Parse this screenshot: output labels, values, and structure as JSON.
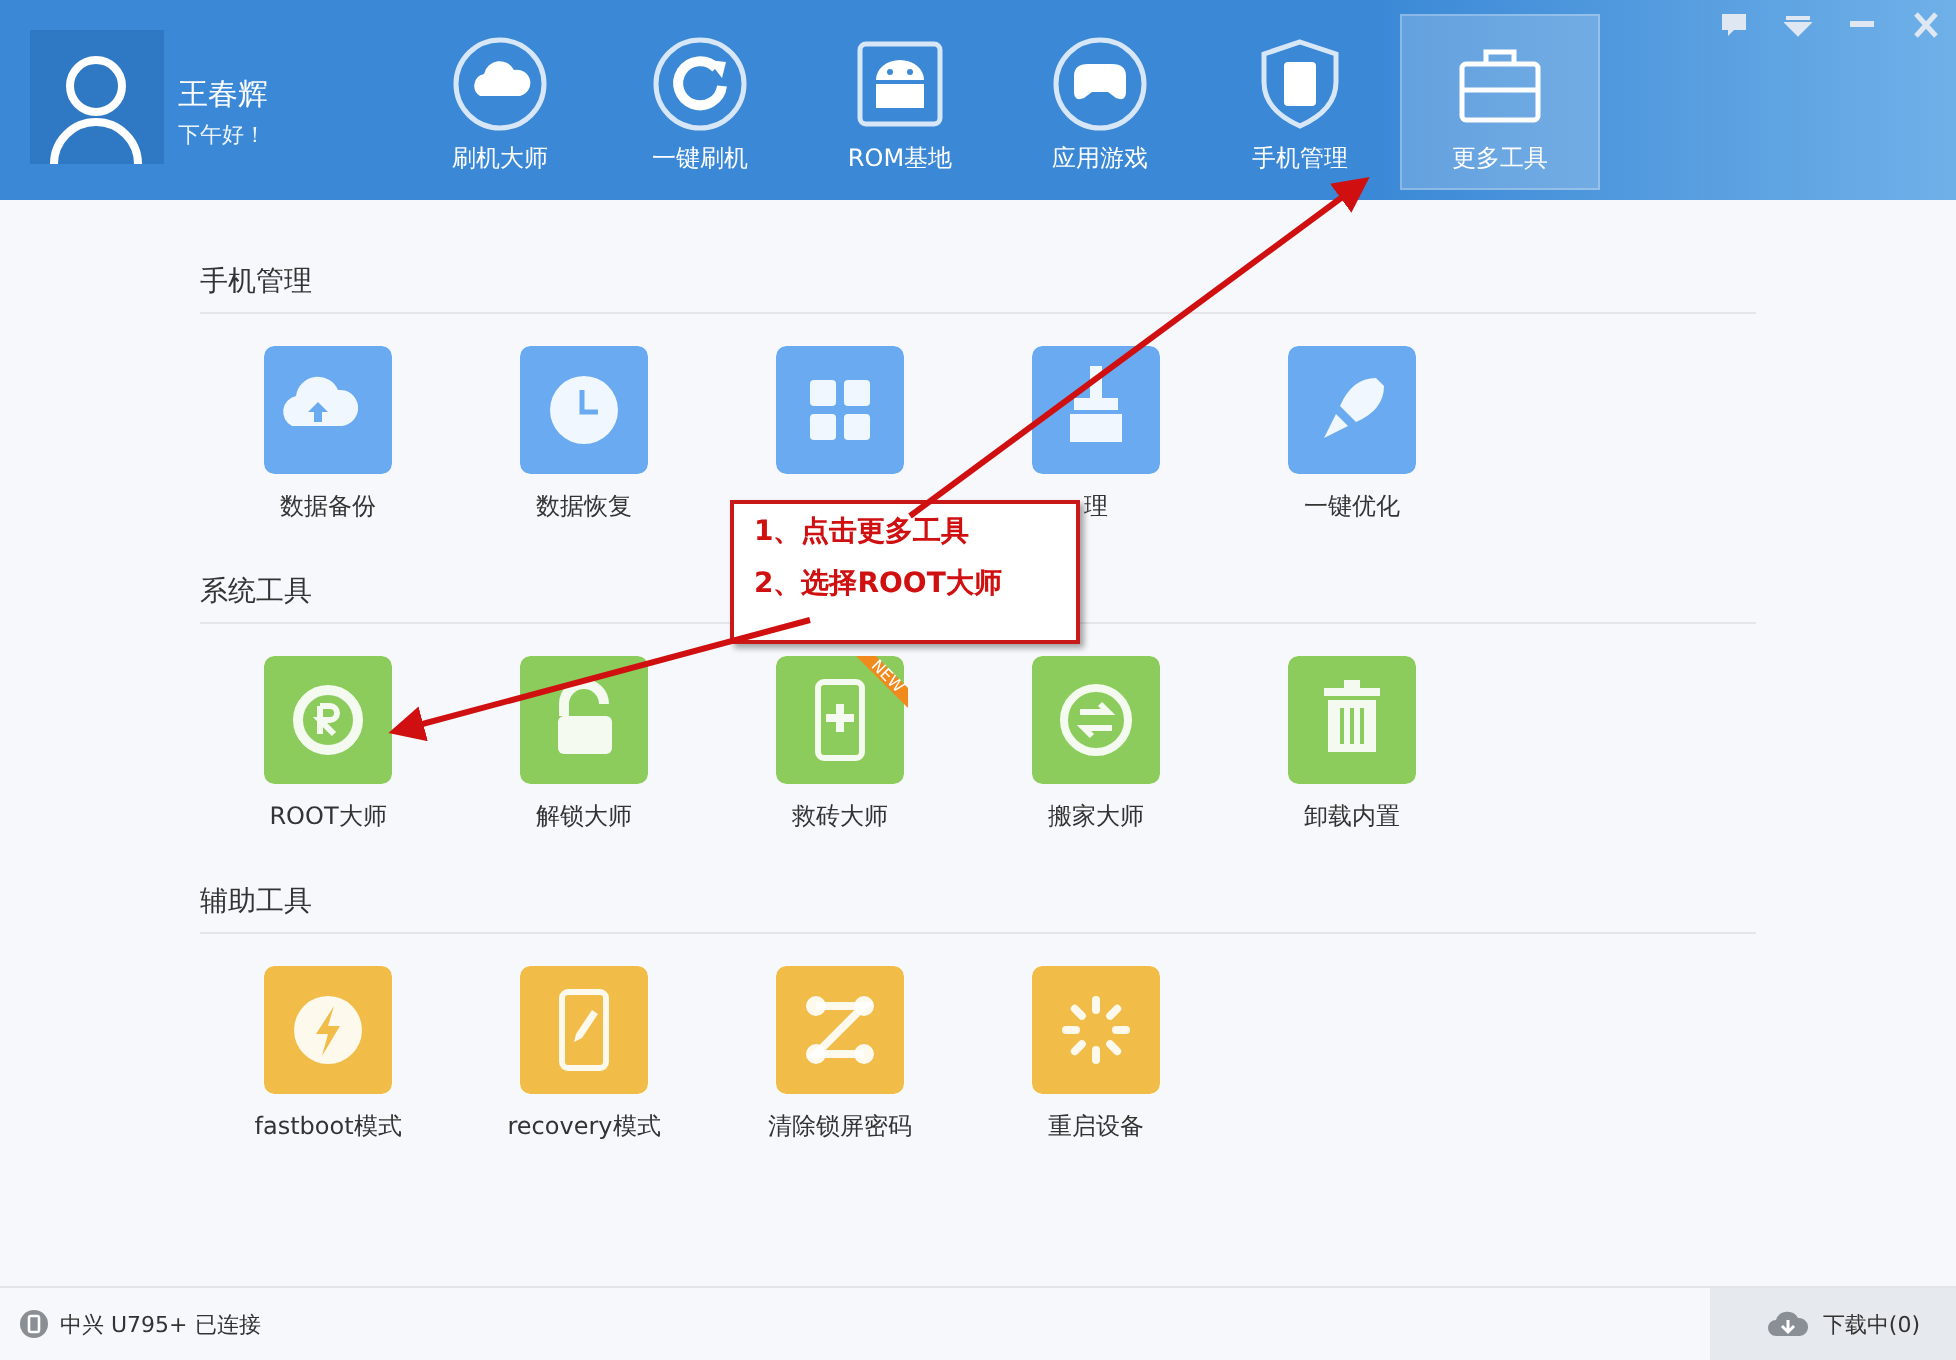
{
  "user": {
    "name": "王春辉",
    "greeting": "下午好！"
  },
  "nav": [
    {
      "label": "刷机大师",
      "selected": false
    },
    {
      "label": "一键刷机",
      "selected": false
    },
    {
      "label": "ROM基地",
      "selected": false
    },
    {
      "label": "应用游戏",
      "selected": false
    },
    {
      "label": "手机管理",
      "selected": false
    },
    {
      "label": "更多工具",
      "selected": true
    }
  ],
  "sections": [
    {
      "title": "手机管理",
      "color": "#6aaaf0",
      "tiles": [
        {
          "kind": "tool",
          "label": "数据备份"
        },
        {
          "kind": "tool",
          "label": "数据恢复"
        },
        {
          "kind": "tool"
        },
        {
          "kind": "tool",
          "label": "理"
        },
        {
          "kind": "tool",
          "label": "一键优化"
        }
      ]
    },
    {
      "title": "系统工具",
      "color": "#8ccc5c",
      "tiles": [
        {
          "kind": "tool",
          "label": "ROOT大师"
        },
        {
          "kind": "tool",
          "label": "解锁大师"
        },
        {
          "kind": "tool",
          "label": "救砖大师",
          "badge": "NEW"
        },
        {
          "kind": "tool",
          "label": "搬家大师"
        },
        {
          "kind": "tool",
          "label": "卸载内置"
        }
      ]
    },
    {
      "title": "辅助工具",
      "color": "#f2bc48",
      "tiles": [
        {
          "kind": "tool",
          "label": "fastboot模式"
        },
        {
          "kind": "tool",
          "label": "recovery模式"
        },
        {
          "kind": "tool",
          "label": "清除锁屏密码"
        },
        {
          "kind": "tool",
          "label": "重启设备"
        }
      ]
    }
  ],
  "callout": {
    "lines": [
      "1、点击更多工具",
      "2、选择ROOT大师"
    ]
  },
  "status_bar": {
    "device": "中兴 U795+ 已连接",
    "downloads": "下载中(0)"
  }
}
